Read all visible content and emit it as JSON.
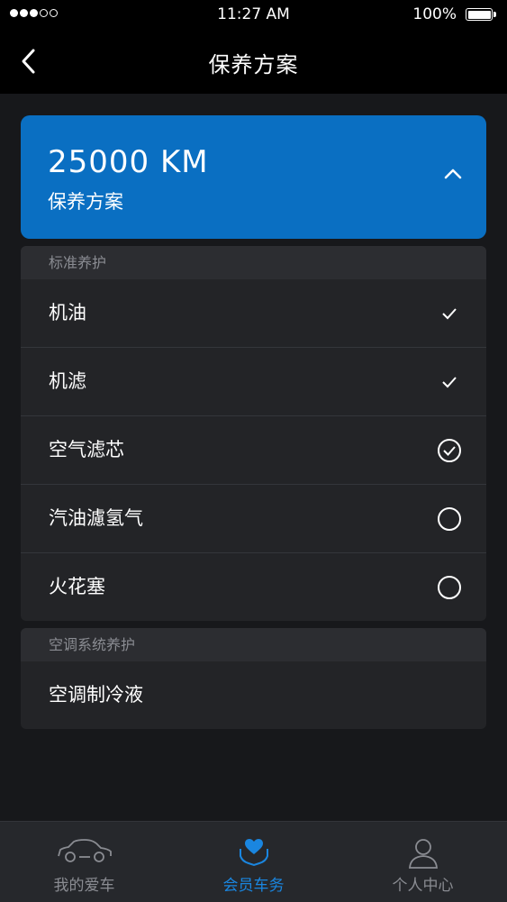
{
  "status_bar": {
    "time": "11:27 AM",
    "battery": "100%",
    "signal_bars": 3,
    "signal_total": 5
  },
  "nav": {
    "title": "保养方案",
    "back_icon": "chevron-left-icon"
  },
  "plan": {
    "mileage": "25000 KM",
    "subtitle": "保养方案",
    "toggle_icon": "chevron-up-icon",
    "expanded": true
  },
  "sections": [
    {
      "header": "标准养护",
      "items": [
        {
          "label": "机油",
          "status": "check"
        },
        {
          "label": "机滤",
          "status": "check"
        },
        {
          "label": "空气滤芯",
          "status": "circle-check"
        },
        {
          "label": "汽油濾氢气",
          "status": "circle"
        },
        {
          "label": "火花塞",
          "status": "circle"
        }
      ]
    },
    {
      "header": "空调系统养护",
      "items": [
        {
          "label": "空调制冷液",
          "status": "none"
        }
      ]
    }
  ],
  "tabs": [
    {
      "label": "我的爱车",
      "icon": "car-icon",
      "active": false
    },
    {
      "label": "会员车务",
      "icon": "heart-hands-icon",
      "active": true
    },
    {
      "label": "个人中心",
      "icon": "person-icon",
      "active": false
    }
  ],
  "colors": {
    "accent": "#0a6fc2",
    "active_tab": "#1a86e0",
    "background": "#17181b",
    "card": "#232427"
  }
}
